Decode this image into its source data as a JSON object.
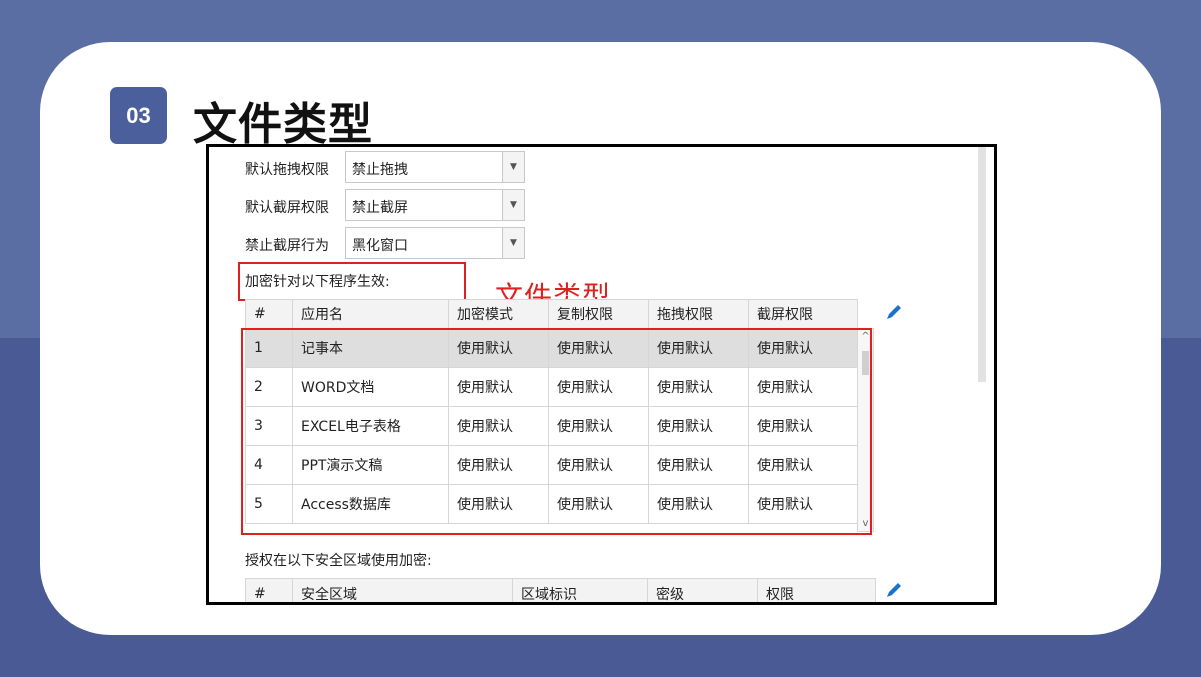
{
  "badge": "03",
  "title": "文件类型",
  "annotation_label": "文件类型",
  "settings": [
    {
      "label": "默认拖拽权限",
      "value": "禁止拖拽"
    },
    {
      "label": "默认截屏权限",
      "value": "禁止截屏"
    },
    {
      "label": "禁止截屏行为",
      "value": "黑化窗口"
    }
  ],
  "apps_section_label": "加密针对以下程序生效:",
  "apps_table": {
    "headers": [
      "#",
      "应用名",
      "加密模式",
      "复制权限",
      "拖拽权限",
      "截屏权限"
    ],
    "rows": [
      [
        "1",
        "记事本",
        "使用默认",
        "使用默认",
        "使用默认",
        "使用默认"
      ],
      [
        "2",
        "WORD文档",
        "使用默认",
        "使用默认",
        "使用默认",
        "使用默认"
      ],
      [
        "3",
        "EXCEL电子表格",
        "使用默认",
        "使用默认",
        "使用默认",
        "使用默认"
      ],
      [
        "4",
        "PPT演示文稿",
        "使用默认",
        "使用默认",
        "使用默认",
        "使用默认"
      ],
      [
        "5",
        "Access数据库",
        "使用默认",
        "使用默认",
        "使用默认",
        "使用默认"
      ]
    ]
  },
  "zones_section_label": "授权在以下安全区域使用加密:",
  "zones_table": {
    "headers": [
      "#",
      "安全区域",
      "区域标识",
      "密级",
      "权限"
    ]
  },
  "icons": {
    "edit": "pencil-icon",
    "dropdown": "triangle-down-icon"
  },
  "colors": {
    "accent": "#4b5f9c",
    "annotation": "#e02020",
    "pencil": "#1a73c8"
  }
}
